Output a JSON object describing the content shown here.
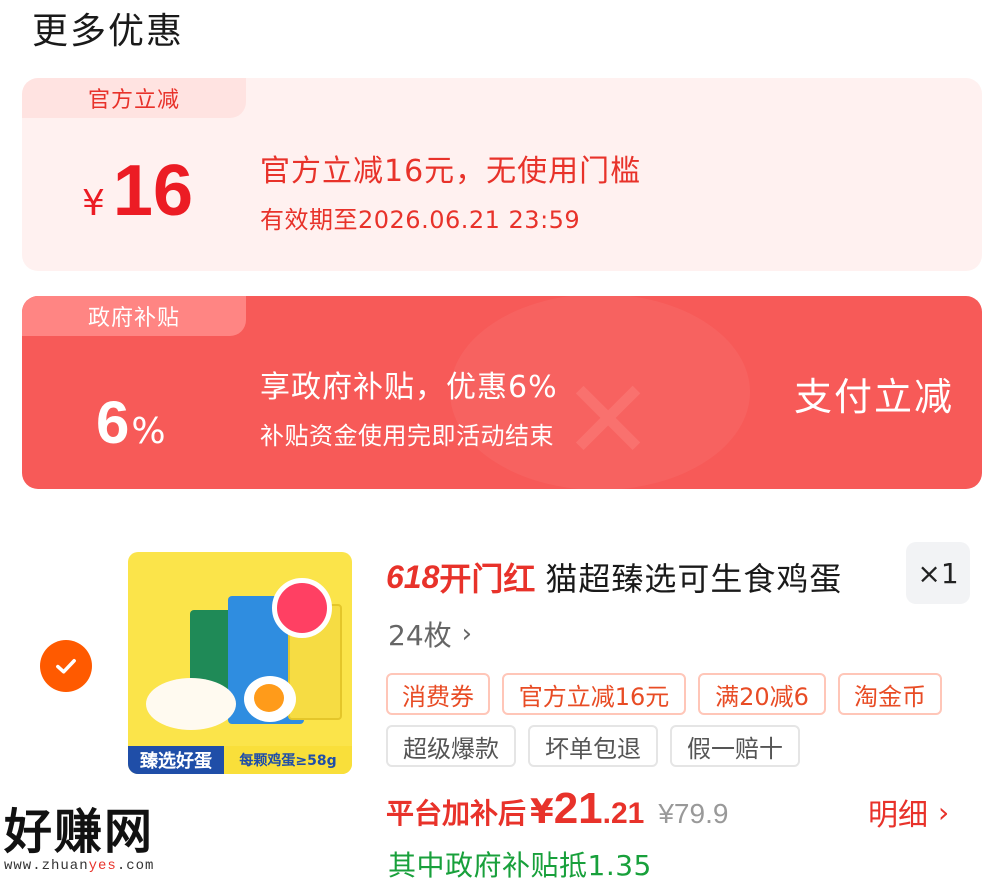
{
  "section": {
    "title": "更多优惠"
  },
  "official_discount": {
    "tag": "官方立减",
    "currency": "¥",
    "amount": "16",
    "main_text": "官方立减16元，无使用门槛",
    "validity": "有效期至2026.06.21 23:59",
    "colors": {
      "background": "#fff1f0",
      "accent": "#e8322a"
    }
  },
  "gov_subsidy": {
    "tag": "政府补贴",
    "percent_num": "6",
    "percent_sign": "%",
    "main_text": "享政府补贴，优惠6%",
    "sub_text": "补贴资金使用完即活动结束",
    "action_label": "支付立减",
    "colors": {
      "background": "#f75a58",
      "text": "#ffffff"
    }
  },
  "product": {
    "selected": true,
    "checkbox_icon": "check-icon",
    "image_alt": "egg-product-image",
    "image_labels": {
      "left_bar": "臻选好蛋",
      "right_bar": "每颗鸡蛋≥58g"
    },
    "title_prefix_618": "618",
    "title_prefix_text": "开门红",
    "title": "猫超臻选可生食鸡蛋",
    "quantity": "×1",
    "spec": "24枚",
    "spec_icon": "chevron-right-icon",
    "promo_chips": [
      "消费券",
      "官方立减16元",
      "满20减6",
      "淘金币"
    ],
    "service_chips": [
      "超级爆款",
      "坏单包退",
      "假一赔十"
    ],
    "price_label": "平台加补后",
    "price_currency": "¥",
    "price_int": "21",
    "price_dec": ".21",
    "original_price": "¥79.9",
    "detail_label": "明细",
    "detail_icon": "chevron-right-icon",
    "gov_deduction": "其中政府补贴抵1.35"
  },
  "watermark": {
    "title": "好赚网",
    "url_prefix": "www.zhuan",
    "url_highlight": "yes",
    "url_suffix": ".com"
  },
  "colors": {
    "brand_red": "#e8322a",
    "orange": "#ff5a00",
    "green": "#18a03b"
  }
}
